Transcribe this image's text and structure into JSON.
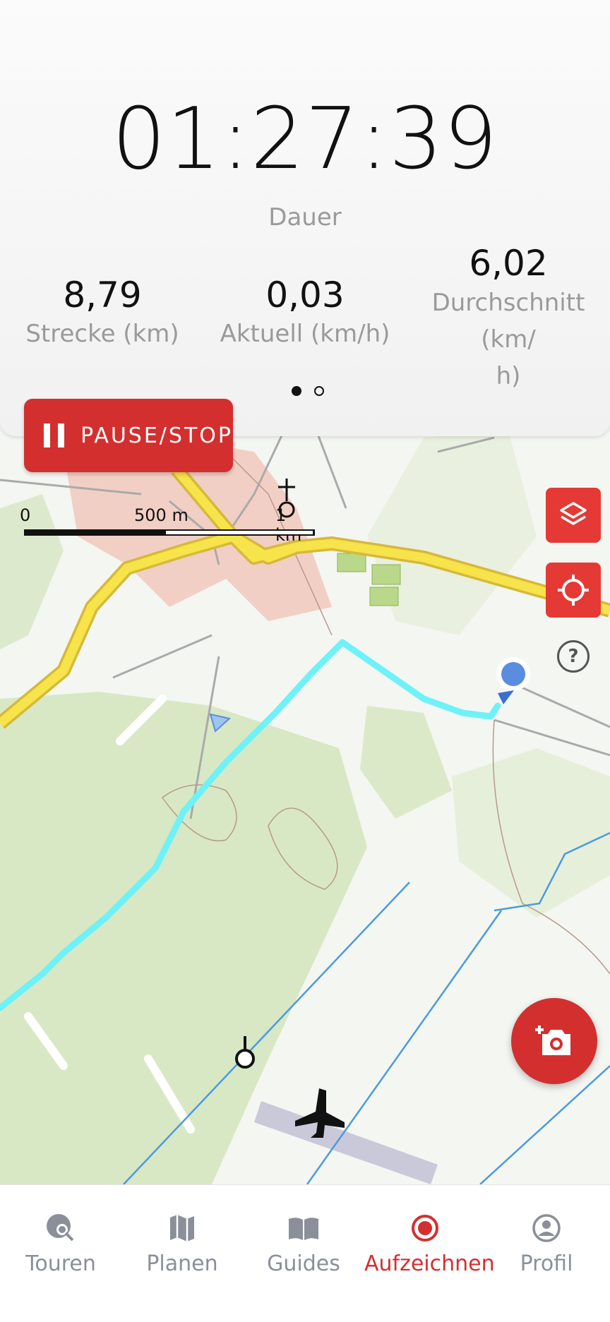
{
  "stats": {
    "duration_value": "01:27:39",
    "duration_label": "Dauer",
    "distance_value": "8,79",
    "distance_label": "Strecke (km)",
    "current_speed_value": "0,03",
    "current_speed_label": "Aktuell (km/h)",
    "avg_speed_value": "6,02",
    "avg_speed_label_line1": "Durchschnitt (km/",
    "avg_speed_label_line2": "h)",
    "page_indicator": {
      "count": 2,
      "active": 1
    }
  },
  "pause_button": {
    "label": "PAUSE/STOP",
    "icon": "pause-icon"
  },
  "map": {
    "scale_labels": [
      "0",
      "500 m",
      "1 km"
    ],
    "layers_button_icon": "layers-icon",
    "locate_button_icon": "crosshair-icon",
    "help_button_label": "?",
    "camera_button_icon": "add-photo-icon",
    "colors": {
      "track": "#6ef2f8",
      "main_road": "#f7e34a",
      "road_border": "#d6b93a",
      "water": "#4a9be0",
      "forest": "#d8e8c4",
      "urban": "#f2cfc4",
      "position": "#5a8de0"
    }
  },
  "nav": {
    "items": [
      {
        "label": "Touren",
        "icon": "tours-search-icon",
        "active": false
      },
      {
        "label": "Planen",
        "icon": "map-icon",
        "active": false
      },
      {
        "label": "Guides",
        "icon": "book-icon",
        "active": false
      },
      {
        "label": "Aufzeichnen",
        "icon": "record-icon",
        "active": true
      },
      {
        "label": "Profil",
        "icon": "profile-icon",
        "active": false
      }
    ],
    "active_color": "#d32f2f",
    "inactive_color": "#8a8f99"
  }
}
